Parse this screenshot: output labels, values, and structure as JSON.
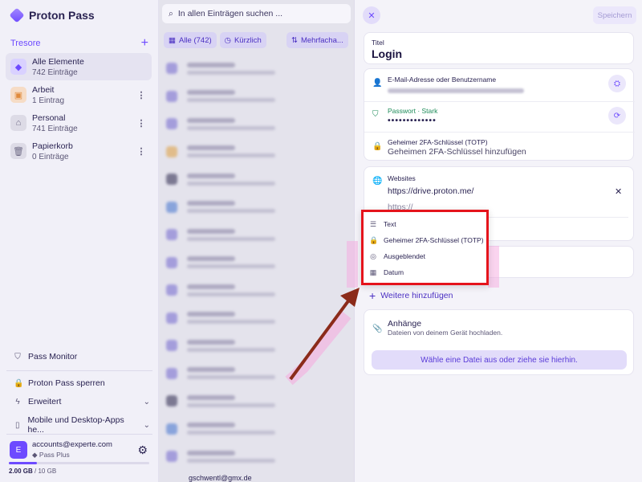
{
  "app": {
    "name": "Proton Pass"
  },
  "sidebar": {
    "vaults_title": "Tresore",
    "vaults": [
      {
        "name": "Alle Elemente",
        "count": "742 Einträge",
        "icon": "diamond-icon",
        "color": "#6d4aff"
      },
      {
        "name": "Arbeit",
        "count": "1 Eintrag",
        "icon": "briefcase-icon",
        "color": "#e08a3c"
      },
      {
        "name": "Personal",
        "count": "741 Einträge",
        "icon": "home-icon",
        "color": "#6f6b86"
      },
      {
        "name": "Papierkorb",
        "count": "0 Einträge",
        "icon": "trash-icon",
        "color": "#6f6b86"
      }
    ],
    "links": {
      "monitor": "Pass Monitor",
      "lock": "Proton Pass sperren",
      "advanced": "Erweitert",
      "apps": "Mobile und Desktop-Apps he..."
    },
    "account": {
      "initial": "E",
      "email": "accounts@experte.com",
      "plan": "Pass Plus"
    },
    "storage": {
      "used": "2.00 GB",
      "total": "/ 10 GB",
      "fraction": 0.2
    }
  },
  "list": {
    "search_placeholder": "In allen Einträgen suchen ...",
    "filter_all": "Alle (742)",
    "filter_recent": "Kürzlich",
    "filter_multi": "Mehrfacha...",
    "last_item_email": "gschwentl@gmx.de"
  },
  "editor": {
    "save_label": "Speichern",
    "title_label": "Titel",
    "title_value": "Login",
    "email_label": "E-Mail-Adresse oder Benutzername",
    "password_label": "Passwort · Stark",
    "password_value": "•••••••••••••",
    "totp_label": "Geheimer 2FA-Schlüssel (TOTP)",
    "totp_placeholder": "Geheimen 2FA-Schlüssel hinzufügen",
    "websites_label": "Websites",
    "website_value": "https://drive.proton.me/",
    "website_placeholder": "https://",
    "add_more": "Weitere hinzufügen",
    "attachments_label": "Anhänge",
    "attachments_hint": "Dateien von deinem Gerät hochladen.",
    "upload_button": "Wähle eine Datei aus oder ziehe sie hierhin."
  },
  "dropdown": {
    "items": [
      {
        "label": "Text",
        "icon": "text-lines-icon"
      },
      {
        "label": "Geheimer 2FA-Schlüssel (TOTP)",
        "icon": "lock-icon"
      },
      {
        "label": "Ausgeblendet",
        "icon": "eye-slash-icon"
      },
      {
        "label": "Datum",
        "icon": "calendar-icon"
      }
    ]
  },
  "annotation": {
    "highlight_color": "#e5141c",
    "arrow_color": "#8b2b1a"
  }
}
